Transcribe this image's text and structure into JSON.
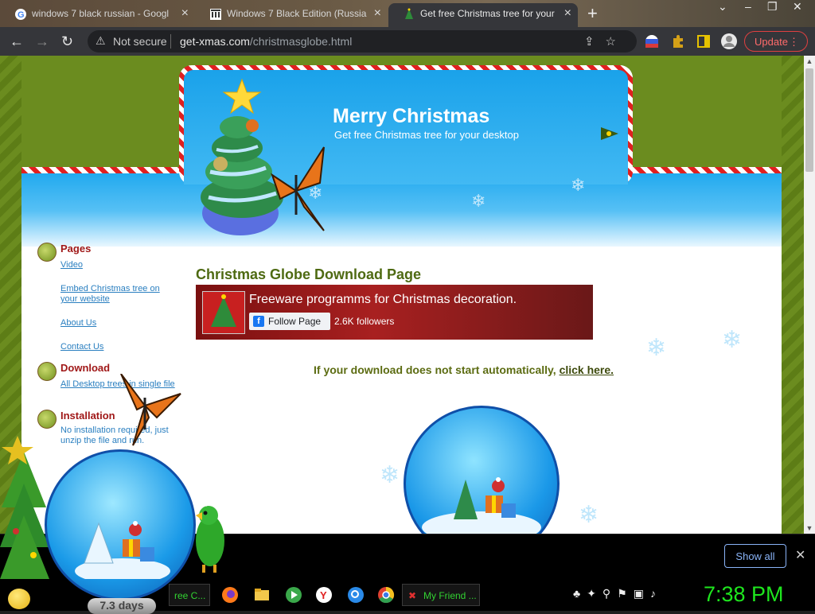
{
  "browser": {
    "tabs": [
      {
        "title": "windows 7 black russian - Googl",
        "icon": "google-icon",
        "active": false
      },
      {
        "title": "Windows 7 Black Edition (Russia",
        "icon": "museum-icon",
        "active": false
      },
      {
        "title": "Get free Christmas tree for your",
        "icon": "tree-favicon",
        "active": true
      }
    ],
    "new_tab": "+",
    "url": {
      "security_label": "Not secure",
      "domain": "get-xmas.com",
      "path": "/christmasglobe.html"
    },
    "update_label": "Update"
  },
  "site": {
    "banner_title": "Merry Christmas",
    "banner_subtitle": "Get free Christmas tree for your desktop",
    "sidebar": {
      "pages_title": "Pages",
      "pages_links": [
        "Video",
        "Embed Christmas tree on your website",
        "About Us",
        "Contact Us"
      ],
      "download_title": "Download",
      "download_link": "All Desktop trees in single file",
      "installation_title": "Installation",
      "installation_text": "No installation required, just unzip the file and run."
    },
    "main_title": "Christmas Globe Download Page",
    "fb": {
      "title": "Freeware programms for Christmas decoration.",
      "follow_label": "Follow Page",
      "followers": "2.6K followers"
    },
    "download_message": "If your download does not start automatically,",
    "download_link": "click here."
  },
  "download_bar": {
    "show_all": "Show all"
  },
  "taskbar": {
    "task_left": "ree C...",
    "task_right": "My Friend ...",
    "clock": "7:38 PM"
  },
  "gadget": {
    "days_label": "7.3 days"
  },
  "colors": {
    "page_green": "#6b8c1f",
    "sky_blue": "#1fa8ee",
    "title_green": "#4e6a12",
    "sidebar_red": "#a01818",
    "link_blue": "#2a7fc0",
    "clock_green": "#1ee61e"
  }
}
